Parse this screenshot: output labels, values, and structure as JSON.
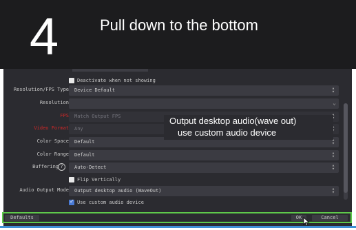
{
  "step": {
    "number": "4",
    "title": "Pull down to the bottom"
  },
  "dialog": {
    "deactivate_checkbox": {
      "label": "Deactivate when not showing",
      "checked": false
    },
    "rows": {
      "resolution_fps_type": {
        "label": "Resolution/FPS Type",
        "value": "Device Default"
      },
      "resolution": {
        "label": "Resolution",
        "value": ""
      },
      "fps": {
        "label": "FPS",
        "value": "Match Output FPS"
      },
      "video_format": {
        "label": "Video Format",
        "value": "Any"
      },
      "color_space": {
        "label": "Color Space",
        "value": "Default"
      },
      "color_range": {
        "label": "Color Range",
        "value": "Default"
      },
      "buffering": {
        "label": "Buffering",
        "value": "Auto-Detect"
      },
      "audio_output_mode": {
        "label": "Audio Output Mode",
        "value": "Output desktop audio (WaveOut)"
      }
    },
    "flip_vertically": {
      "label": "Flip Vertically",
      "checked": false
    },
    "use_custom_audio": {
      "label": "Use custom audio device",
      "checked": true
    }
  },
  "callout": {
    "line1": "Output desktop audio(wave out)",
    "line2": "use custom audio device"
  },
  "buttons": {
    "defaults": "Defaults",
    "ok": "OK",
    "cancel": "Cancel"
  },
  "colors": {
    "highlight_border": "#5ec94b",
    "accent_line": "#3e8fd6",
    "warning_label": "#d02828"
  },
  "icons": {
    "help": "help-circle-icon",
    "spinner": "spin-arrows-icon",
    "dropdown": "chevron-down-icon",
    "cursor": "mouse-cursor-icon"
  }
}
